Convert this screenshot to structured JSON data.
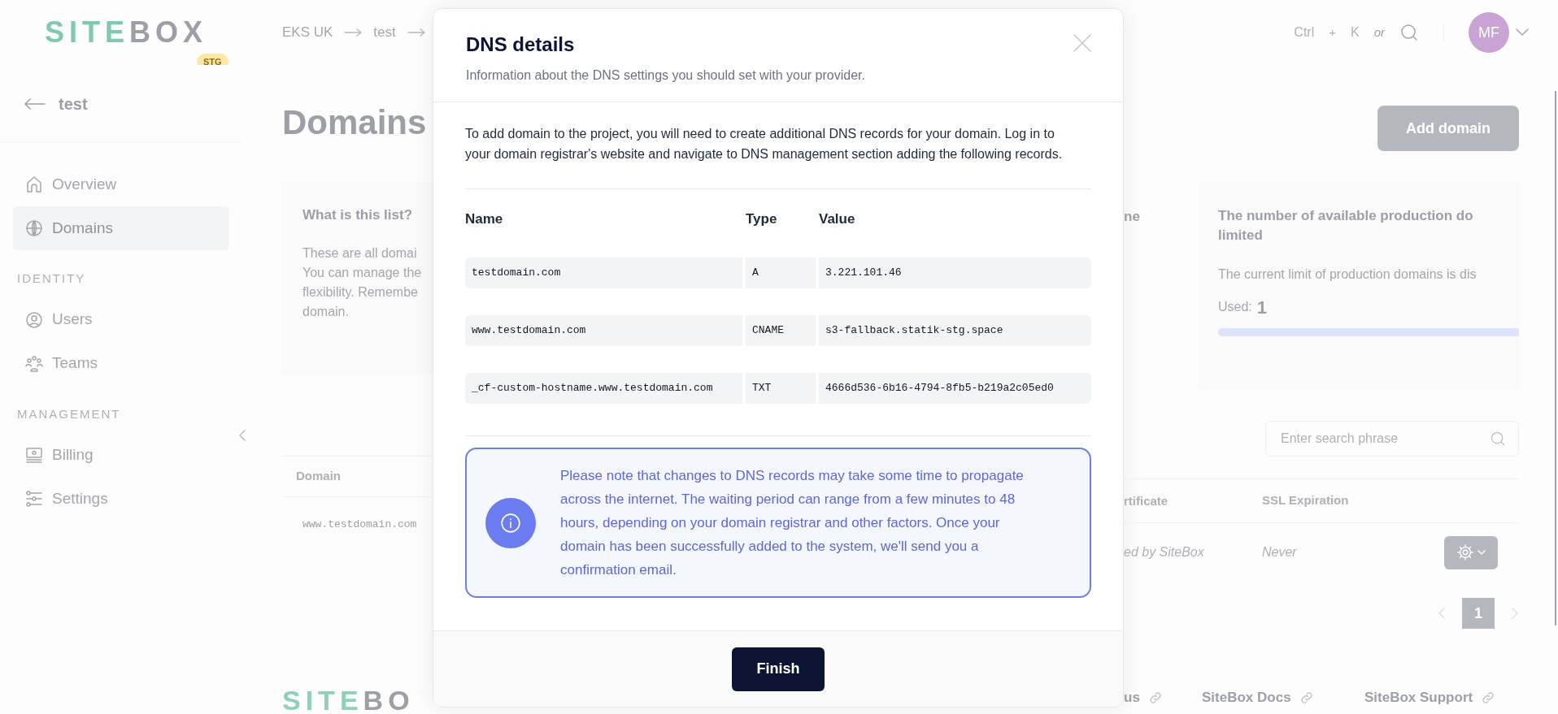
{
  "header": {
    "logo": "SITEBOX",
    "logo_badge": "STG",
    "breadcrumb": [
      "EKS UK",
      "test"
    ],
    "shortcut_keys": [
      "Ctrl",
      "K"
    ],
    "shortcut_plus": "+",
    "shortcut_or": "or",
    "avatar": "MF"
  },
  "sidebar": {
    "back": "test",
    "sections": [
      {
        "items": [
          {
            "label": "Overview",
            "kind": "home",
            "selected": false
          },
          {
            "label": "Domains",
            "kind": "globe",
            "selected": true
          }
        ]
      },
      {
        "heading": "IDENTITY",
        "items": [
          {
            "label": "Users",
            "kind": "user",
            "selected": false
          },
          {
            "label": "Teams",
            "kind": "team",
            "selected": false
          }
        ]
      },
      {
        "heading": "MANAGEMENT",
        "items": [
          {
            "label": "Billing",
            "kind": "billing",
            "selected": false
          },
          {
            "label": "Settings",
            "kind": "sliders",
            "selected": false
          }
        ]
      }
    ]
  },
  "page": {
    "title": "Domains",
    "add_button": "Add domain",
    "cards": [
      {
        "title_lines": [
          "What is this list?"
        ],
        "body_lines": [
          "These are all domai",
          "You can manage the",
          "flexibility. Remembe",
          "domain."
        ]
      },
      {
        "title_lines": [
          "ne"
        ]
      },
      {
        "title_lines": [
          "The number of available production do",
          "limited"
        ],
        "body_lines": [
          "The current limit of production domains is dis"
        ],
        "used_label": "Used:",
        "used_value": "1",
        "level": 1
      }
    ],
    "search": {
      "placeholder": "Enter search phrase"
    },
    "table": {
      "columns": [
        "Domain",
        "rtificate",
        "SSL Expiration"
      ],
      "rows": [
        {
          "cells": [
            "www.testdomain.com",
            "ed by SiteBox",
            "Never"
          ]
        }
      ]
    },
    "pagination": [
      {
        "label": "1",
        "selected": true
      }
    ]
  },
  "footer": {
    "logo": "SITEBO",
    "links": [
      "us",
      "SiteBox Docs",
      "SiteBox Support"
    ]
  },
  "dialog": {
    "title": "DNS details",
    "subtitle": "Information about the DNS settings you should set with your provider.",
    "intro": "To add domain to the project, you will need to create additional DNS records for your domain. Log in to your domain registrar's website and navigate to DNS management section adding the following records.",
    "columns": [
      "Name",
      "Type",
      "Value"
    ],
    "records": [
      {
        "name": "testdomain.com",
        "type": "A",
        "value": "3.221.101.46"
      },
      {
        "name": "www.testdomain.com",
        "type": "CNAME",
        "value": "s3-fallback.statik-stg.space"
      },
      {
        "name": "_cf-custom-hostname.www.testdomain.com",
        "type": "TXT",
        "value": "4666d536-6b16-4794-8fb5-b219a2c05ed0"
      }
    ],
    "note": "Please note that changes to DNS records may take some time to propagate across the internet. The waiting period can range from a few minutes to 48 hours, depending on your domain registrar and other factors. Once your domain has been successfully added to the system, we'll send you a confirmation email.",
    "button": "Finish"
  }
}
